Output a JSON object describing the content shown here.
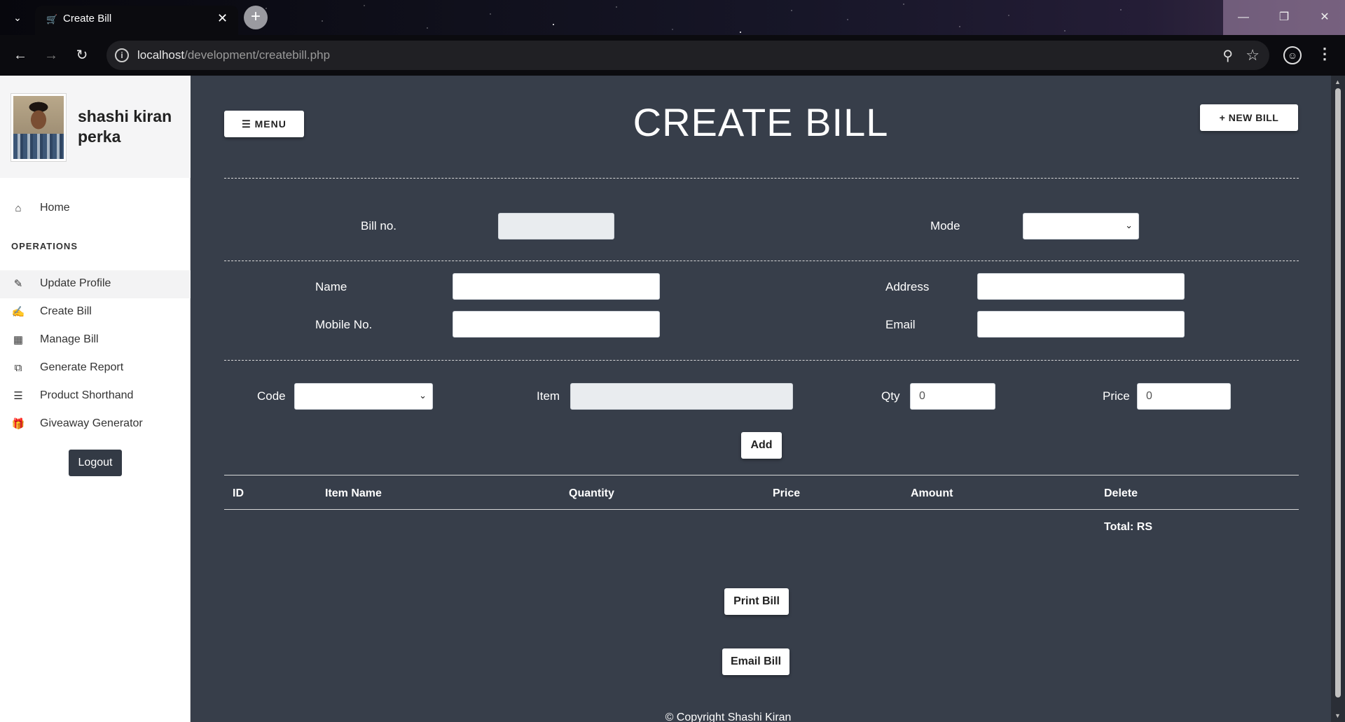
{
  "browser": {
    "tab_title": "Create Bill",
    "url_host": "localhost",
    "url_path": "/development/createbill.php"
  },
  "sidebar": {
    "user_name": "shashi kiran perka",
    "home_label": "Home",
    "section_heading": "OPERATIONS",
    "items": [
      {
        "label": "Update Profile",
        "icon": "update-profile-icon"
      },
      {
        "label": "Create Bill",
        "icon": "edit-icon"
      },
      {
        "label": "Manage Bill",
        "icon": "bar-chart-icon"
      },
      {
        "label": "Generate Report",
        "icon": "report-icon"
      },
      {
        "label": "Product Shorthand",
        "icon": "list-icon"
      },
      {
        "label": "Giveaway Generator",
        "icon": "gift-icon"
      }
    ],
    "logout_label": "Logout"
  },
  "header": {
    "menu_label": "MENU",
    "title": "CREATE BILL",
    "new_bill_label": "NEW BILL"
  },
  "form": {
    "bill_no_label": "Bill no.",
    "bill_no_value": "",
    "mode_label": "Mode",
    "mode_value": "",
    "name_label": "Name",
    "name_value": "",
    "address_label": "Address",
    "address_value": "",
    "mobile_label": "Mobile No.",
    "mobile_value": "",
    "email_label": "Email",
    "email_value": "",
    "code_label": "Code",
    "code_value": "",
    "item_label": "Item",
    "item_value": "",
    "qty_label": "Qty",
    "qty_value": "0",
    "price_label": "Price",
    "price_value": "0",
    "add_label": "Add"
  },
  "table": {
    "headers": [
      "ID",
      "Item Name",
      "Quantity",
      "Price",
      "Amount",
      "Delete"
    ],
    "rows": [],
    "total_label": "Total: RS"
  },
  "actions": {
    "print_label": "Print Bill",
    "email_label": "Email Bill"
  },
  "footer": {
    "copyright": "© Copyright Shashi Kiran"
  },
  "colors": {
    "main_bg": "#373e4a",
    "sidebar_bg": "#ffffff",
    "logout_bg": "#333a45"
  }
}
